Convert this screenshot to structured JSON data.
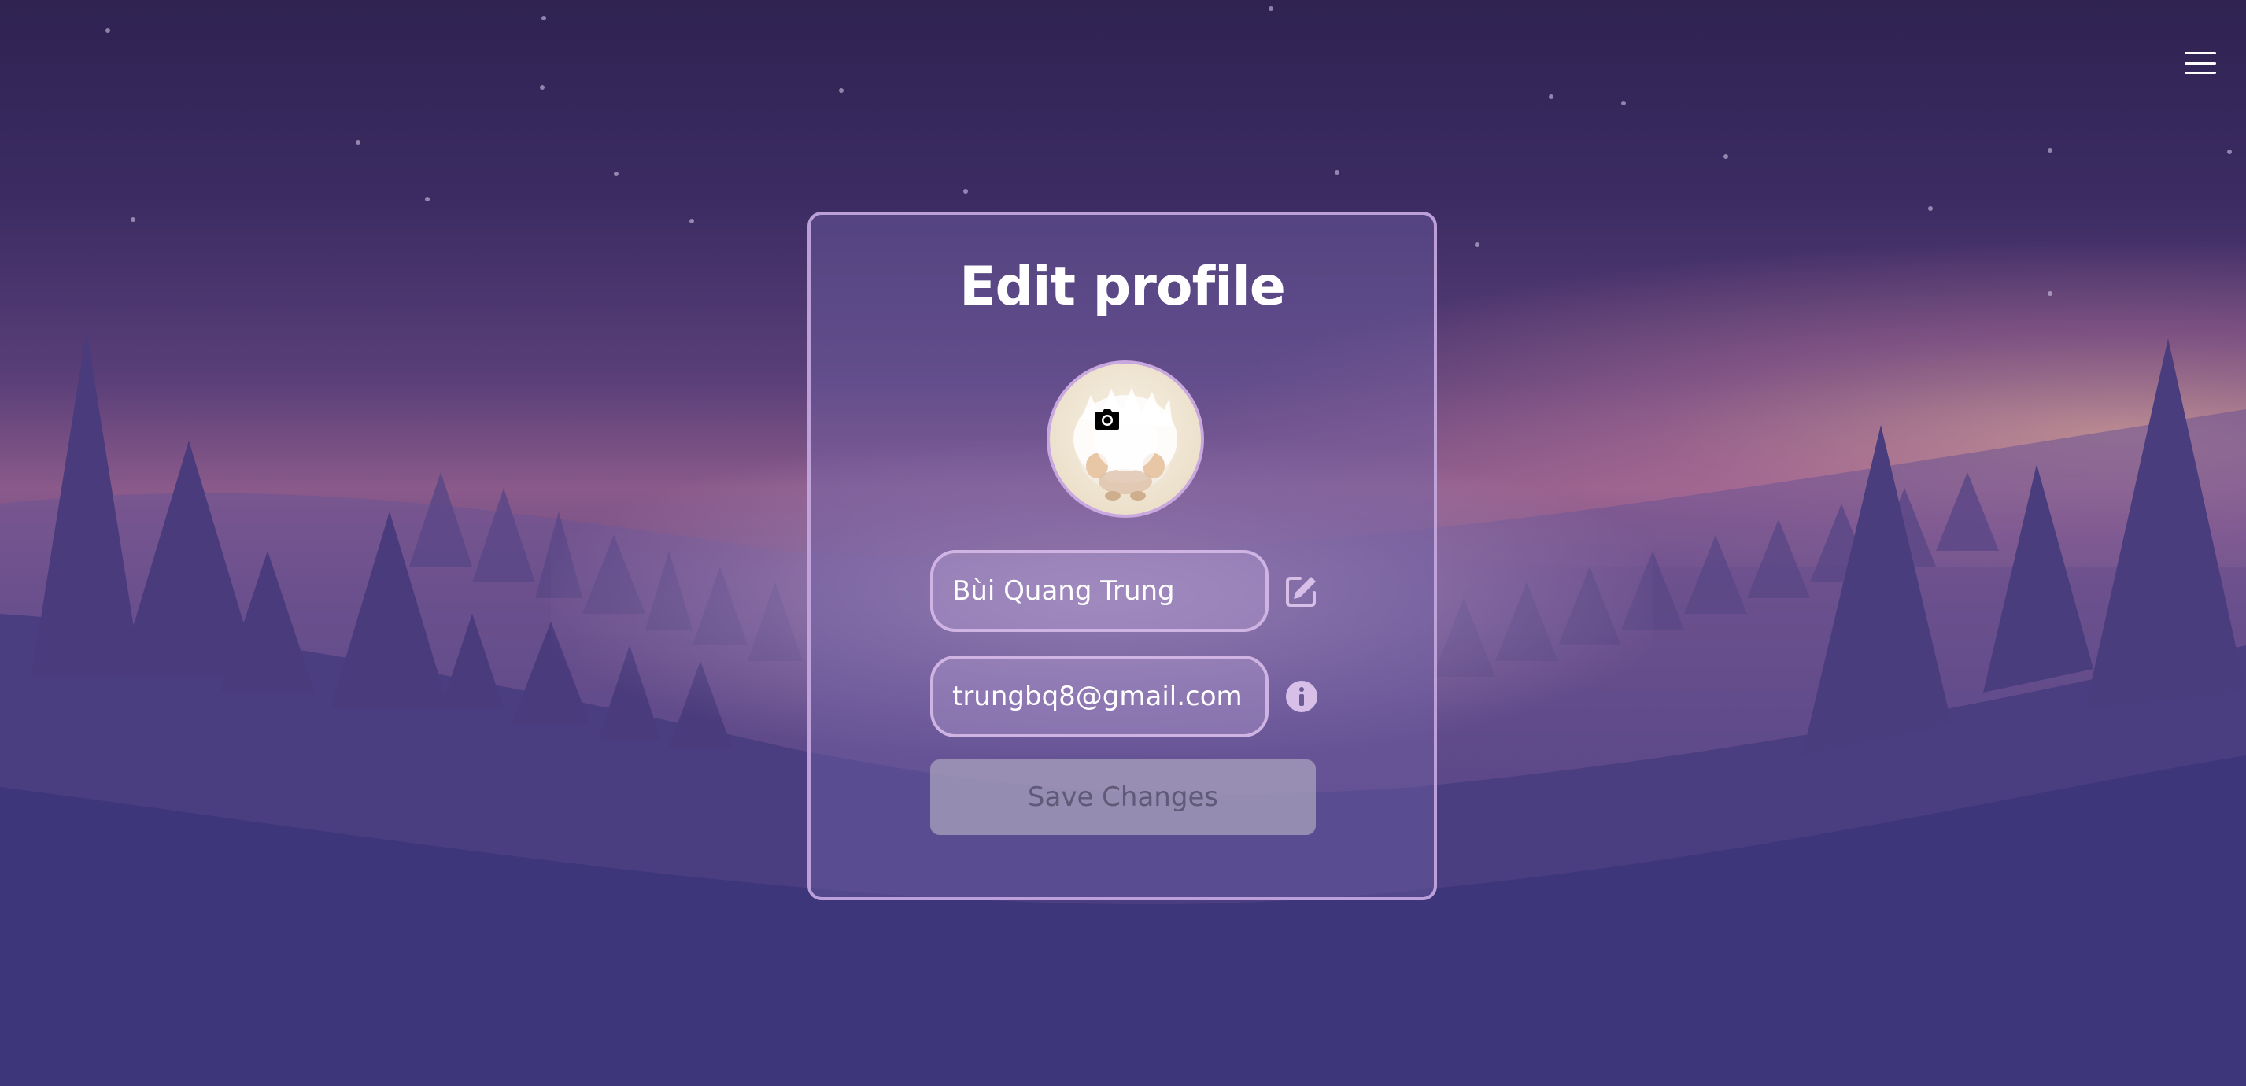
{
  "menu": {
    "icon": "hamburger-menu-icon"
  },
  "profile": {
    "title": "Edit profile",
    "avatar_alt": "profile avatar",
    "camera_icon": "camera-icon",
    "name_value": "Bùi Quang Trung",
    "email_value": "trungbq8@gmail.com",
    "edit_icon": "edit-icon",
    "info_icon": "info-icon",
    "save_label": "Save Changes"
  },
  "colors": {
    "card_border": "#c9a8df",
    "field_border": "#cfb3e3",
    "save_button_bg": "#aaa2be",
    "save_button_text": "#5f5a78"
  }
}
